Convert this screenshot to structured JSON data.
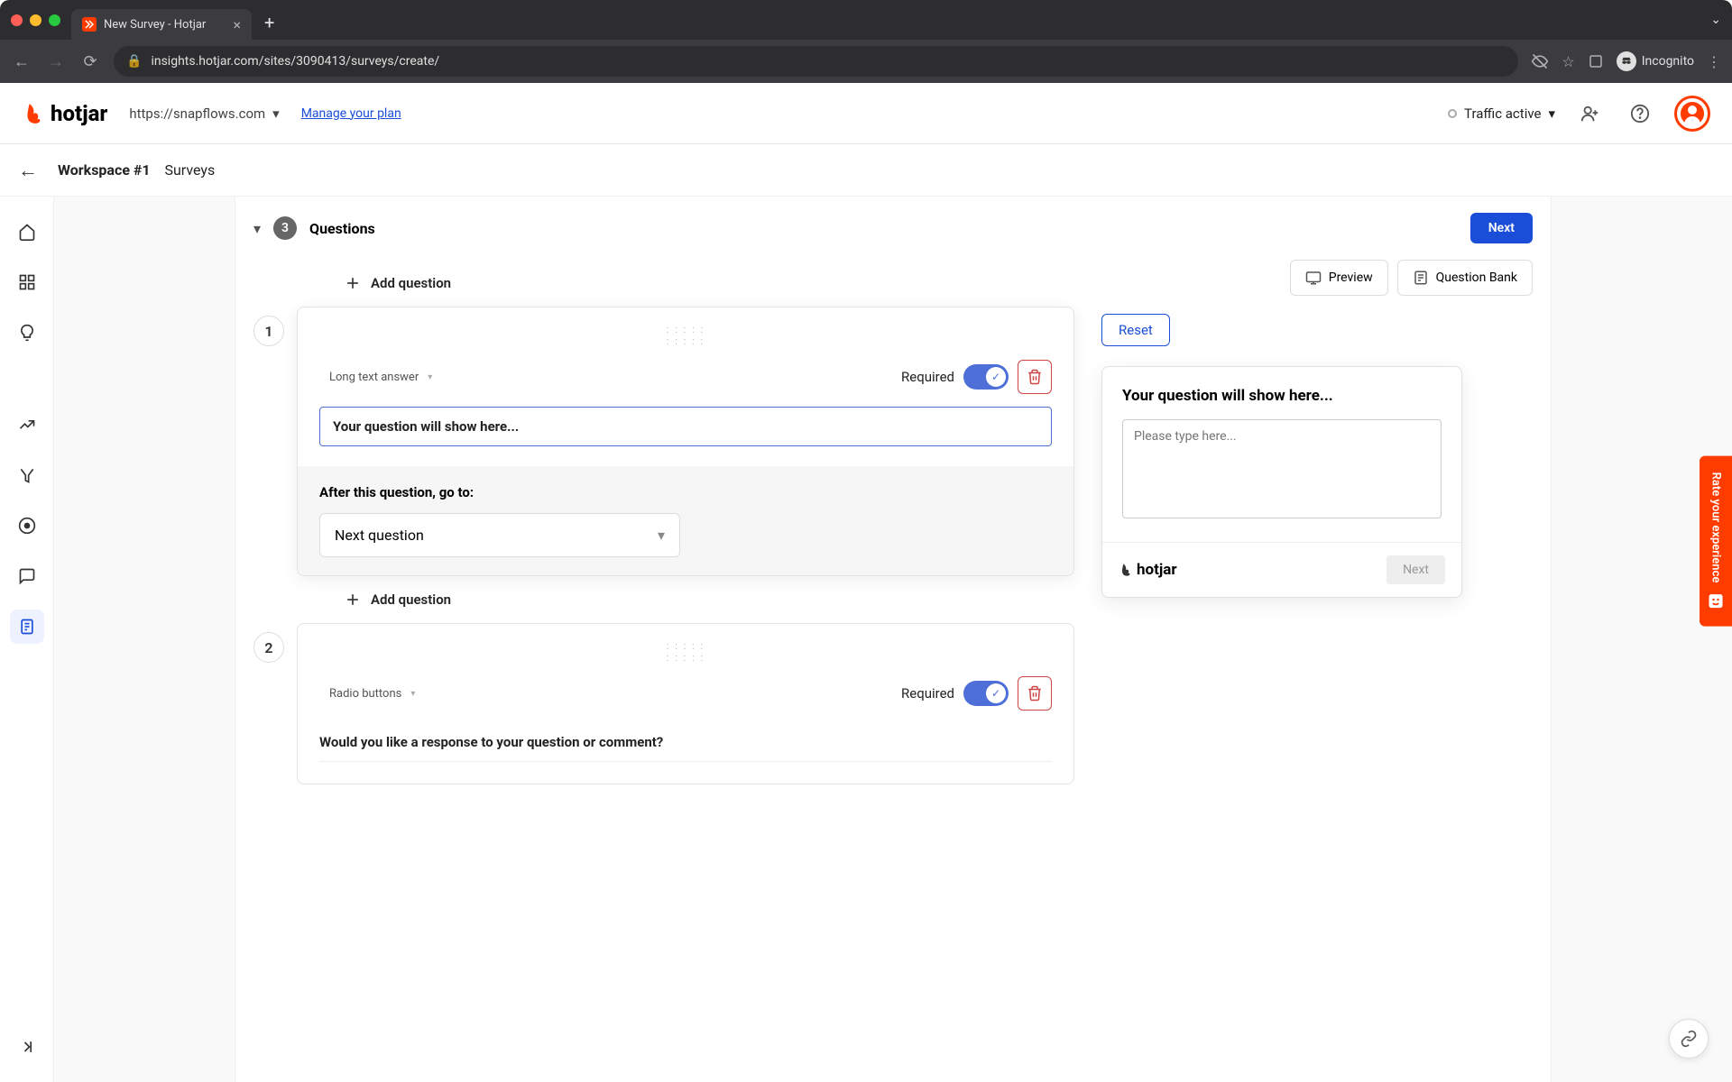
{
  "browser": {
    "tab_title": "New Survey - Hotjar",
    "url": "insights.hotjar.com/sites/3090413/surveys/create/",
    "incognito_label": "Incognito"
  },
  "header": {
    "brand": "hotjar",
    "site_url": "https://snapflows.com",
    "manage_plan": "Manage your plan",
    "traffic_status": "Traffic active"
  },
  "breadcrumb": {
    "workspace": "Workspace #1",
    "section": "Surveys"
  },
  "section": {
    "step_number": "3",
    "title": "Questions",
    "next_button": "Next"
  },
  "add_question_label": "Add question",
  "questions": [
    {
      "number": "1",
      "type_label": "Long text answer",
      "required_label": "Required",
      "required": true,
      "question_text": "Your question will show here...",
      "after_label": "After this question, go to:",
      "goto_value": "Next question"
    },
    {
      "number": "2",
      "type_label": "Radio buttons",
      "required_label": "Required",
      "required": true,
      "question_text": "Would you like a response to your question or comment?"
    }
  ],
  "preview": {
    "preview_btn": "Preview",
    "question_bank_btn": "Question Bank",
    "reset_btn": "Reset",
    "title": "Your question will show here...",
    "placeholder": "Please type here...",
    "brand": "hotjar",
    "next_btn": "Next"
  },
  "feedback_tab": "Rate your experience"
}
